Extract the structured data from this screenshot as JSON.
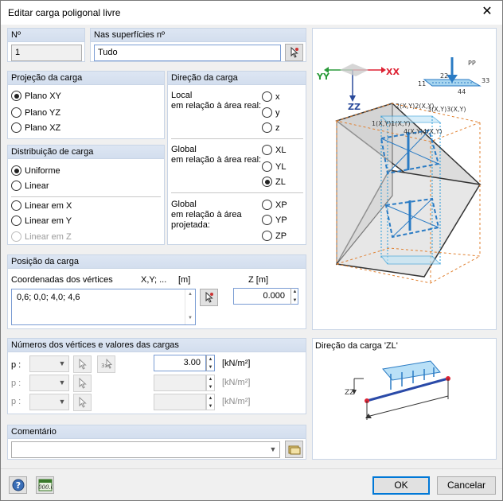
{
  "window": {
    "title": "Editar carga poligonal livre",
    "close": "✕"
  },
  "no": {
    "header": "Nº",
    "value": "1"
  },
  "surfaces": {
    "header": "Nas superfícies nº",
    "value": "Tudo"
  },
  "projection": {
    "header": "Projeção da carga",
    "options": [
      "Plano XY",
      "Plano YZ",
      "Plano XZ"
    ],
    "selected": 0
  },
  "direction": {
    "header": "Direção da carga",
    "local_label": "Local\nem relação à área real:",
    "local_options": [
      "x",
      "y",
      "z"
    ],
    "global_label": "Global\nem relação à área real:",
    "global_options": [
      "XL",
      "YL",
      "ZL"
    ],
    "proj_label": "Global\nem relação à área\nprojetada:",
    "proj_options": [
      "XP",
      "YP",
      "ZP"
    ],
    "selected": "ZL"
  },
  "distribution": {
    "header": "Distribuição de carga",
    "options": [
      "Uniforme",
      "Linear",
      "Linear em X",
      "Linear em Y",
      "Linear em Z"
    ],
    "selected": 0
  },
  "position": {
    "header": "Posição da carga",
    "coords_label": "Coordenadas dos vértices",
    "xy_label": "X,Y; ...",
    "unit": "[m]",
    "coords_value": "0,6; 0,0; 4,0; 4,6",
    "z_label": "Z  [m]",
    "z_value": "0.000"
  },
  "vertices": {
    "header": "Números dos vértices e valores das cargas",
    "rows": [
      {
        "label": "p :",
        "value": "3.00",
        "unit": "[kN/m²]"
      },
      {
        "label": "p :",
        "value": "",
        "unit": "[kN/m²]"
      },
      {
        "label": "p :",
        "value": "",
        "unit": "[kN/m²]"
      }
    ]
  },
  "comment": {
    "header": "Comentário",
    "value": ""
  },
  "preview": {
    "caption": "Direção da carga 'ZL'",
    "axes": {
      "x": "X",
      "y": "Y",
      "z": "Z"
    },
    "icon_labels": [
      "P",
      "1",
      "2",
      "3",
      "4"
    ],
    "vertex_labels": [
      "1(X,Y)",
      "2(X,Y)",
      "3(X,Y)",
      "4(X,Y)"
    ]
  },
  "footer": {
    "ok": "OK",
    "cancel": "Cancelar",
    "calc": "0.00"
  },
  "colors": {
    "accent": "#0078d7",
    "header": "#d3deee",
    "load": "#2a7bc4"
  }
}
